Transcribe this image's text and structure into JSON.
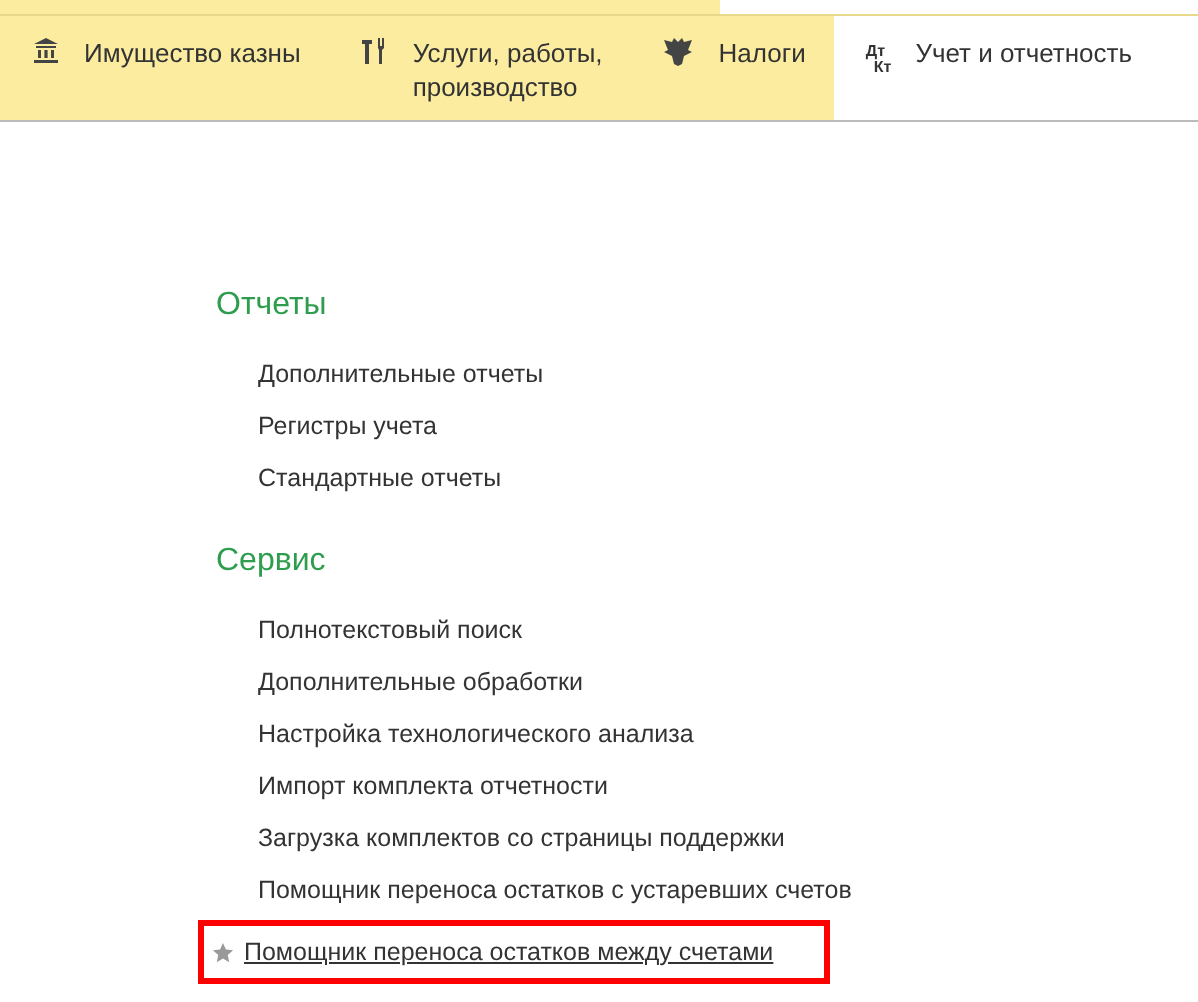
{
  "tabs": [
    {
      "label": "Имущество казны",
      "selected": false
    },
    {
      "label": "Услуги, работы,\nпроизводство",
      "selected": false
    },
    {
      "label": "Налоги",
      "selected": false
    },
    {
      "label": "Учет и отчетность",
      "icon_text": [
        "Дт",
        "Кт"
      ],
      "selected": true
    }
  ],
  "sections": [
    {
      "title": "Отчеты",
      "items": [
        {
          "label": "Дополнительные отчеты",
          "starred": false,
          "highlighted": false
        },
        {
          "label": "Регистры учета",
          "starred": false,
          "highlighted": false
        },
        {
          "label": "Стандартные отчеты",
          "starred": false,
          "highlighted": false
        }
      ]
    },
    {
      "title": "Сервис",
      "items": [
        {
          "label": "Полнотекстовый поиск",
          "starred": false,
          "highlighted": false
        },
        {
          "label": "Дополнительные обработки",
          "starred": false,
          "highlighted": false
        },
        {
          "label": "Настройка технологического анализа",
          "starred": false,
          "highlighted": false
        },
        {
          "label": "Импорт комплекта отчетности",
          "starred": false,
          "highlighted": false
        },
        {
          "label": "Загрузка комплектов со страницы поддержки",
          "starred": false,
          "highlighted": false
        },
        {
          "label": "Помощник переноса остатков с устаревших счетов",
          "starred": false,
          "highlighted": false
        },
        {
          "label": "Помощник переноса остатков между счетами",
          "starred": true,
          "highlighted": true
        }
      ]
    }
  ]
}
